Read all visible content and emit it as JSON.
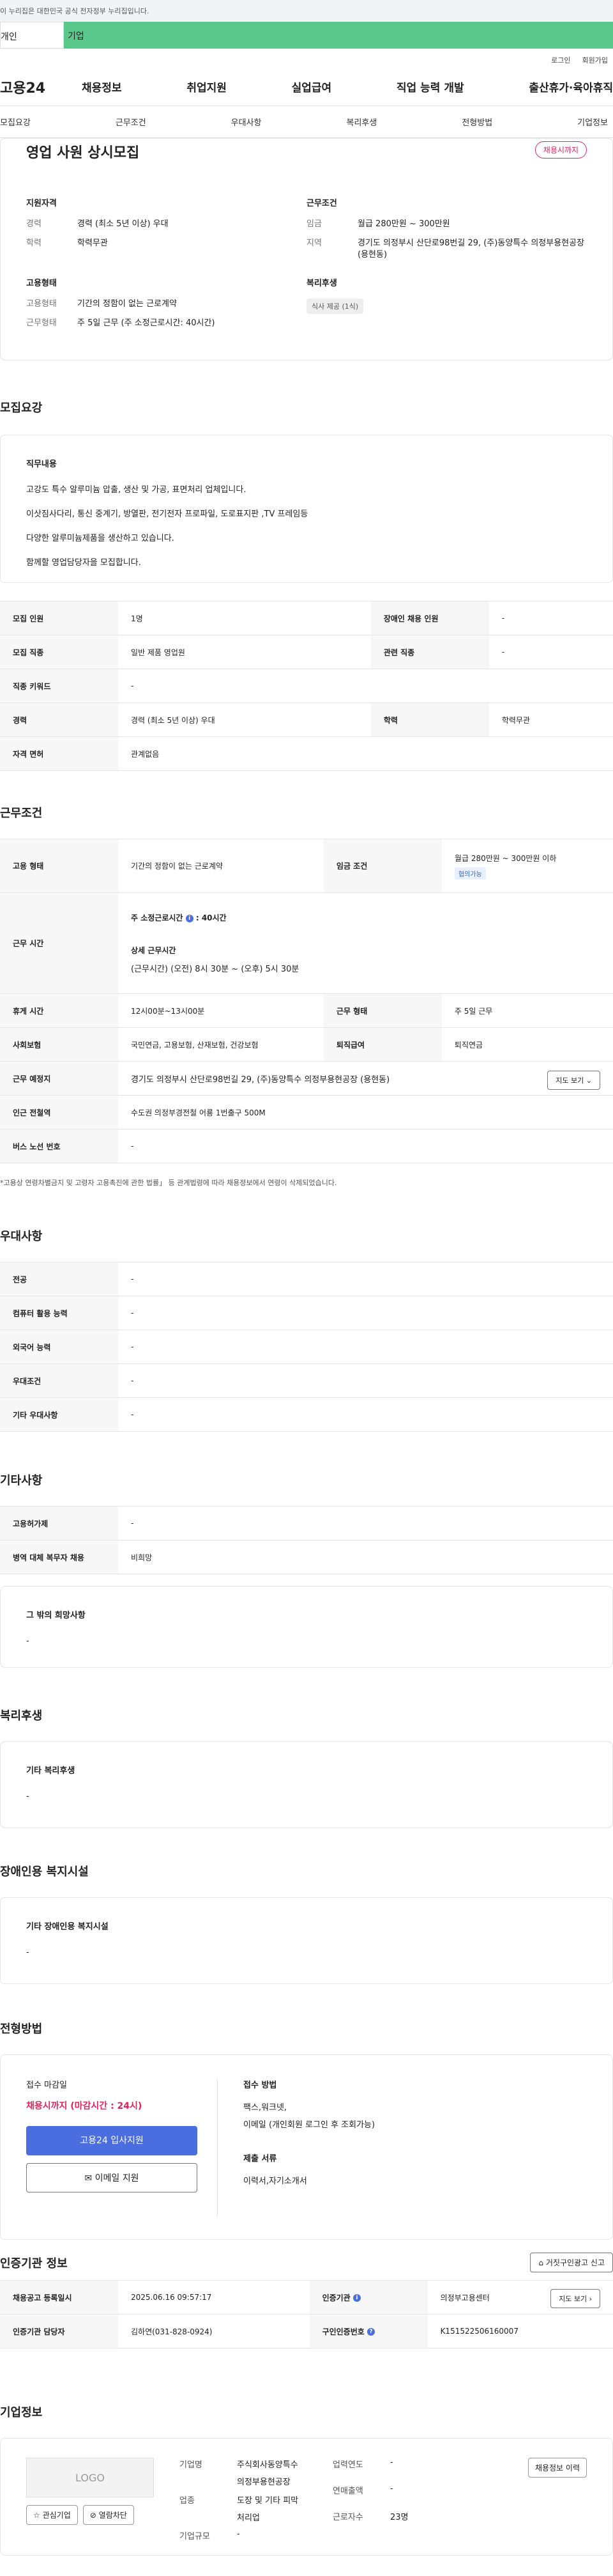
{
  "gov_banner": "이 누리집은 대한민국 공식 전자정부 누리집입니다.",
  "top_tabs": {
    "tab1": "개인",
    "tab2": "기업"
  },
  "util": {
    "login": "로그인",
    "signup": "회원가입"
  },
  "logo": "고용24",
  "gnb": [
    "채용정보",
    "취업지원",
    "실업급여",
    "직업 능력 개발",
    "출산휴가·육아휴직"
  ],
  "tabnav": [
    "모집요강",
    "근무조건",
    "우대사항",
    "복리후생",
    "전형방법",
    "기업정보"
  ],
  "summary": {
    "title": "영업 사원 상시모집",
    "badge": "채용시까지",
    "left_heading": "지원자격",
    "experience_label": "경력",
    "experience_value": "경력 (최소 5년 이상) 우대",
    "education_label": "학력",
    "education_value": "학력무관",
    "emp_heading": "고용형태",
    "emp_label": "고용형태",
    "emp_value": "기간의 정함이 없는 근로계약",
    "work_label": "근무형태",
    "work_value": "주 5일 근무 (주 소정근로시간: 40시간)",
    "right_heading": "근무조건",
    "wage_label": "임금",
    "wage_value": "월급 280만원 ~ 300만원",
    "loc_label": "지역",
    "loc_value": "경기도 의정부시 산단로98번길 29, (주)동양특수 의정부용현공장 (용현동)",
    "welfare_heading": "복리후생",
    "welfare_tag": "식사 제공 (1식)"
  },
  "recruit": {
    "title": "모집요강",
    "duty_heading": "직무내용",
    "duty_lines": [
      "고강도 특수 알루미늄 압출, 생산 및 가공, 표면처리 업체입니다.",
      "이삿짐사다리, 통신 중계기, 방열판, 전기전자 프로파일, 도로표지판 ,TV 프레임등",
      "다양한 알루미늄제품을 생산하고 있습니다.",
      "함께할 영업담당자을 모집합니다."
    ],
    "rows": {
      "r1k1": "모집 인원",
      "r1v1": "1명",
      "r1k2": "장애인 채용 인원",
      "r1v2": "-",
      "r2k1": "모집 직종",
      "r2v1": "일반 제품 영업원",
      "r2k2": "관련 직종",
      "r2v2": "-",
      "r3k1": "직종 키워드",
      "r3v1": "-",
      "r4k1": "경력",
      "r4v1": "경력 (최소 5년 이상) 우대",
      "r4k2": "학력",
      "r4v2": "학력무관",
      "r5k1": "자격 면허",
      "r5v1": "관계없음"
    }
  },
  "cond": {
    "title": "근무조건",
    "emp_type_k": "고용 형태",
    "emp_type_v": "기간의 정함이 없는 근로계약",
    "wage_k": "임금 조건",
    "wage_v": "월급 280만원 ~ 300만원 이하",
    "wage_tag": "협의가능",
    "hours_k": "근무 시간",
    "hours_weekly": "주 소정근로시간",
    "hours_weekly_v": ": 40시간",
    "hours_detail_h": "상세 근무시간",
    "hours_detail_v": "(근무시간) (오전) 8시 30분 ~ (오후) 5시 30분",
    "break_k": "휴게 시간",
    "break_v": "12시00분~13시00분",
    "form_k": "근무 형태",
    "form_v": "주 5일 근무",
    "insurance_k": "사회보험",
    "insurance_v": "국민연금, 고용보험, 산재보험, 건강보험",
    "retire_k": "퇴직급여",
    "retire_v": "퇴직연금",
    "place_k": "근무 예정지",
    "place_v": "경기도 의정부시 산단로98번길 29, (주)동양특수 의정부용현공장 (용현동)",
    "map_btn": "지도 보기",
    "station_k": "인근 전철역",
    "station_v": "수도권 의정부경전철 어룡 1번출구 500M",
    "bus_k": "버스 노선 번호",
    "bus_v": "-",
    "note": "*고용상 연령차별금지 및 고령자 고용촉진에 관한 법률」 등 관계법령에 따라 채용정보에서 연령이 삭제되었습니다."
  },
  "pref": {
    "title": "우대사항",
    "rows": [
      {
        "k": "전공",
        "v": "-"
      },
      {
        "k": "컴퓨터 활용 능력",
        "v": "-"
      },
      {
        "k": "외국어 능력",
        "v": "-"
      },
      {
        "k": "우대조건",
        "v": "-"
      },
      {
        "k": "기타 우대사항",
        "v": "-"
      }
    ]
  },
  "etc": {
    "title": "기타사항",
    "rows": [
      {
        "k": "고용허가제",
        "v": "-"
      },
      {
        "k": "병역 대체 복무자 채용",
        "v": "비희망"
      }
    ],
    "box_h": "그 밖의 희망사항",
    "box_v": "-"
  },
  "welfare": {
    "title": "복리후생",
    "box_h": "기타 복리후생",
    "box_v": "-"
  },
  "disabled": {
    "title": "장애인용 복지시설",
    "box_h": "기타 장애인용 복지시설",
    "box_v": "-"
  },
  "apply": {
    "title": "전형방법",
    "deadline_h": "접수 마감일",
    "deadline_v": "채용시까지 (마감시간 : 24시)",
    "btn1": "고용24 입사지원",
    "btn2": "이메일 지원",
    "method_h": "접수 방법",
    "method_lines": [
      "팩스,워크넷,",
      "이메일 (개인회원 로그인 후 조회가능)"
    ],
    "docs_h": "제출 서류",
    "docs_v": "이력서,자기소개서"
  },
  "auth": {
    "title": "인증기관 정보",
    "report_btn": "거짓구인광고 신고",
    "reg_k": "채용공고 등록일시",
    "reg_v": "2025.06.16 09:57:17",
    "org_k": "인증기관",
    "org_v": "의정부고용센터",
    "map_btn": "지도 보기",
    "mgr_k": "인증기관 담당자",
    "mgr_v": "김하연(031-828-0924)",
    "num_k": "구인인증번호",
    "num_v": "K151522506160007"
  },
  "company": {
    "title": "기업정보",
    "logo": "LOGO",
    "fav_btn": "관심기업",
    "block_btn": "열람차단",
    "name_k": "기업명",
    "name_v1": "주식회사동양특수",
    "name_v2": "의정부용현공장",
    "ind_k": "업종",
    "ind_v1": "도장 및 기타 피막",
    "ind_v2": "처리업",
    "size_k": "기업규모",
    "size_v": "-",
    "year_k": "업력연도",
    "year_v": "-",
    "sales_k": "연매출액",
    "sales_v": "-",
    "emp_k": "근로자수",
    "emp_v": "23명",
    "more_btn": "채용정보 이력"
  }
}
